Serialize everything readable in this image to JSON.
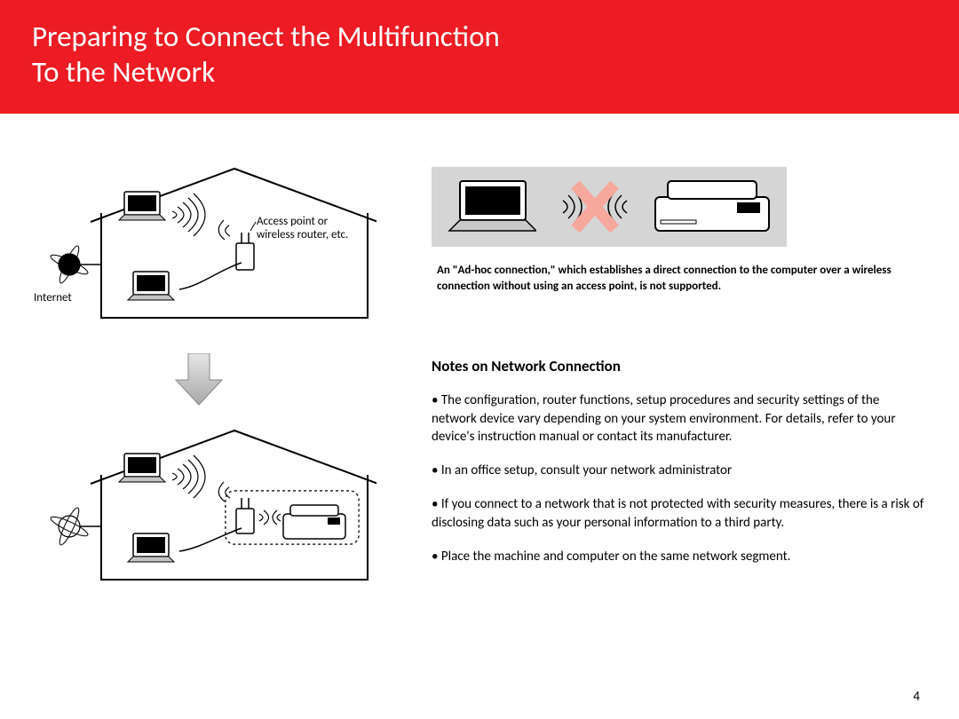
{
  "header": {
    "title_line1": "Preparing to Connect the Multifunction",
    "title_line2": "To the Network"
  },
  "left": {
    "internet_label": "Internet",
    "access_point_label_line1": "Access point or",
    "access_point_label_line2": "wireless router, etc."
  },
  "right": {
    "adhoc_note": "An \"Ad-hoc connection,\" which establishes a direct connection to the computer over a wireless connection without using an access point, is not supported.",
    "notes_heading": "Notes on Network Connection",
    "notes": [
      "The configuration, router functions, setup procedures and security settings of the network device vary depending on your system environment. For details, refer to your device's instruction manual or contact its manufacturer.",
      "In an office setup, consult your network administrator",
      "If you connect to a network that is not protected with security measures, there is a risk of disclosing data such as your personal information to a third party.",
      "Place the machine and computer on the same network segment."
    ]
  },
  "page_number": "4"
}
